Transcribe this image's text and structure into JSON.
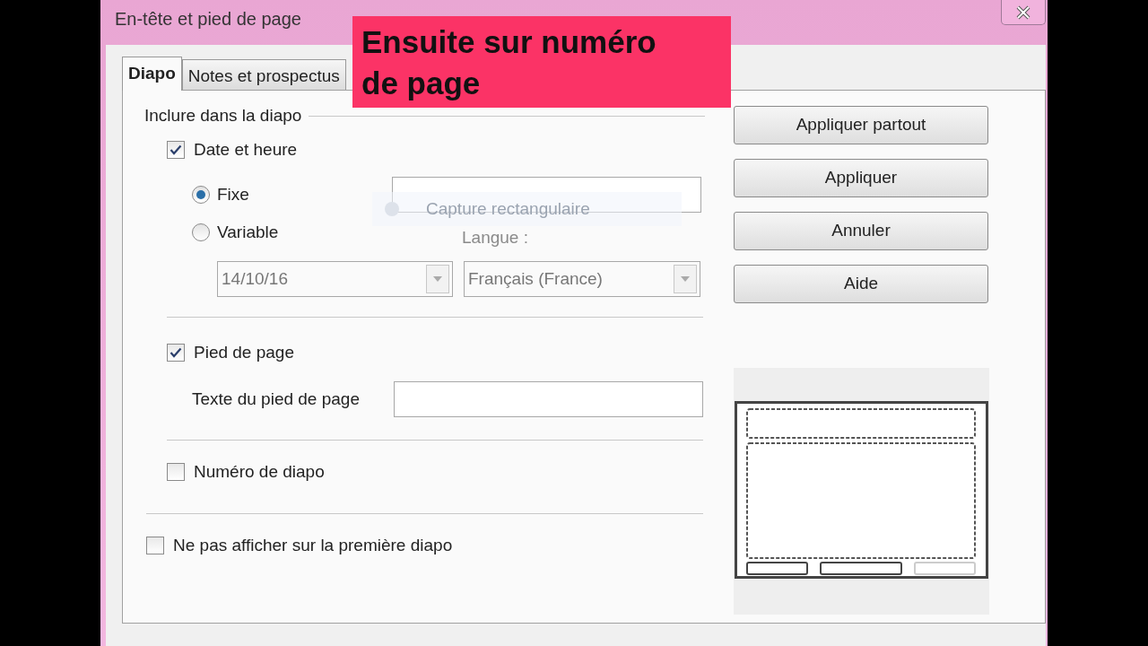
{
  "window": {
    "title": "En-tête et pied de page"
  },
  "tabs": [
    {
      "label": "Diapo",
      "selected": true
    },
    {
      "label": "Notes et prospectus",
      "selected": false
    }
  ],
  "callout": {
    "text": "Ensuite sur numéro de page"
  },
  "group": {
    "label": "Inclure dans la diapo"
  },
  "date_time": {
    "label": "Date et heure",
    "checked": true,
    "modes": [
      {
        "label": "Fixe",
        "selected": true
      },
      {
        "label": "Variable",
        "selected": false
      }
    ],
    "date_format": {
      "value": "14/10/16",
      "disabled": true
    },
    "language": {
      "label": "Langue :",
      "value": "Français (France)",
      "disabled": true
    }
  },
  "footer": {
    "label": "Pied de page",
    "checked": true,
    "text_label": "Texte du pied de page"
  },
  "slide_number": {
    "label": "Numéro de diapo",
    "checked": false
  },
  "hide_on_first": {
    "label": "Ne pas afficher sur la première diapo",
    "checked": false
  },
  "buttons": [
    {
      "label": "Appliquer partout"
    },
    {
      "label": "Appliquer"
    },
    {
      "label": "Annuler"
    },
    {
      "label": "Aide"
    }
  ],
  "tooltip": {
    "text": "Capture rectangulaire"
  }
}
